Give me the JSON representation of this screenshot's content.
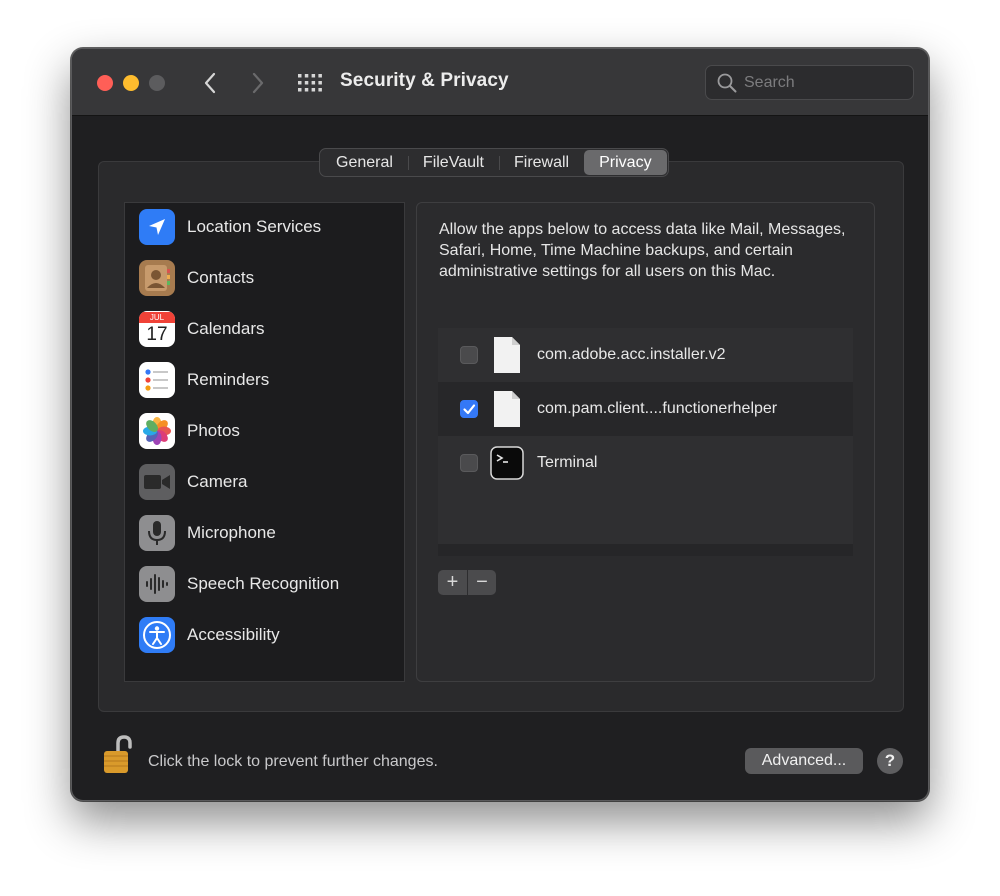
{
  "window": {
    "title": "Security & Privacy"
  },
  "search": {
    "placeholder": "Search",
    "value": ""
  },
  "tabs": [
    {
      "label": "General"
    },
    {
      "label": "FileVault"
    },
    {
      "label": "Firewall"
    },
    {
      "label": "Privacy",
      "active": true
    }
  ],
  "sidebar": {
    "items": [
      {
        "label": "Location Services",
        "icon": "location-arrow-icon",
        "color": "#2f7cf6"
      },
      {
        "label": "Contacts",
        "icon": "contacts-icon",
        "color": "#a77b4f"
      },
      {
        "label": "Calendars",
        "icon": "calendar-icon",
        "month": "JUL",
        "day": "17"
      },
      {
        "label": "Reminders",
        "icon": "reminders-icon"
      },
      {
        "label": "Photos",
        "icon": "photos-icon"
      },
      {
        "label": "Camera",
        "icon": "camera-icon"
      },
      {
        "label": "Microphone",
        "icon": "microphone-icon"
      },
      {
        "label": "Speech Recognition",
        "icon": "speech-waveform-icon"
      },
      {
        "label": "Accessibility",
        "icon": "accessibility-icon",
        "color": "#2f7cf6"
      }
    ]
  },
  "panel": {
    "description": "Allow the apps below to access data like Mail, Messages, Safari, Home, Time Machine backups, and certain administrative settings for all users on this Mac.",
    "apps": [
      {
        "name": "com.adobe.acc.installer.v2",
        "checked": false,
        "icon": "document-icon"
      },
      {
        "name": "com.pam.client....functionerhelper",
        "checked": true,
        "icon": "document-icon"
      },
      {
        "name": "Terminal",
        "checked": false,
        "icon": "terminal-icon"
      }
    ],
    "add_label": "+",
    "remove_label": "−"
  },
  "footer": {
    "lock_text": "Click the lock to prevent further changes.",
    "advanced_label": "Advanced...",
    "help_label": "?"
  },
  "colors": {
    "accent": "#3478f6",
    "window_bg": "#1f1f21",
    "titlebar": "#373739"
  }
}
